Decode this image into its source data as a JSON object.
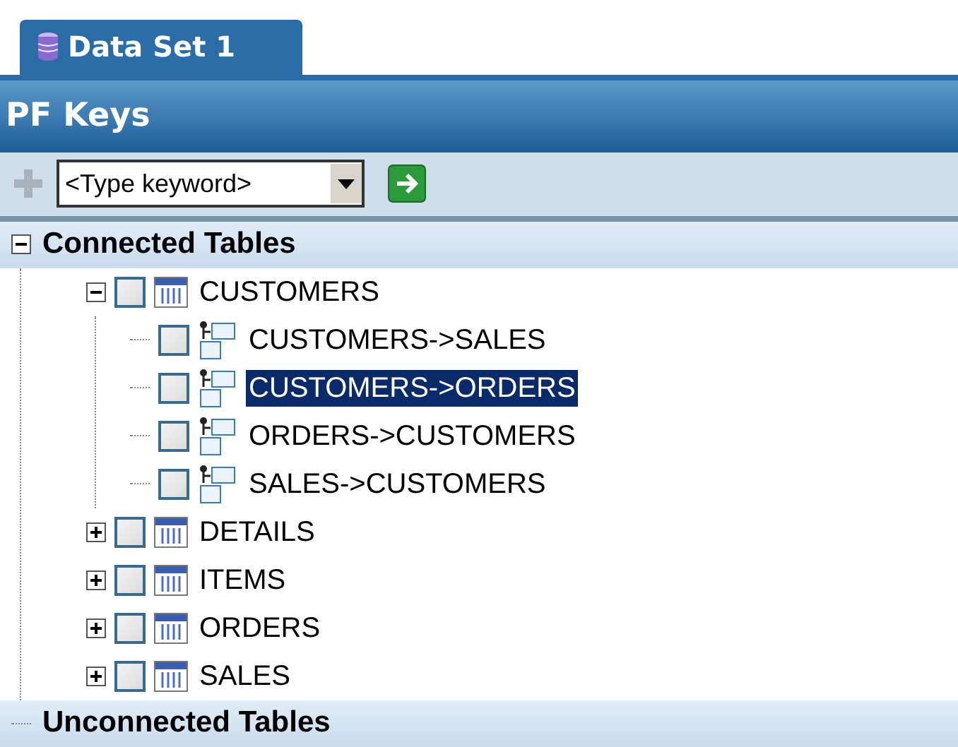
{
  "tab": {
    "label": "Data Set 1",
    "selected": true
  },
  "panel": {
    "title": "PF Keys"
  },
  "toolbar": {
    "search": {
      "placeholder": "<Type keyword>"
    }
  },
  "tree": [
    {
      "label": "Connected Tables",
      "expanded": true,
      "children": [
        {
          "kind": "table",
          "label": "CUSTOMERS",
          "expanded": true,
          "checked": false,
          "selected": false,
          "children": [
            {
              "kind": "relation",
              "label": "CUSTOMERS->SALES",
              "checked": false,
              "selected": false
            },
            {
              "kind": "relation",
              "label": "CUSTOMERS->ORDERS",
              "checked": false,
              "selected": true
            },
            {
              "kind": "relation",
              "label": "ORDERS->CUSTOMERS",
              "checked": false,
              "selected": false
            },
            {
              "kind": "relation",
              "label": "SALES->CUSTOMERS",
              "checked": false,
              "selected": false
            }
          ]
        },
        {
          "kind": "table",
          "label": "DETAILS",
          "expanded": false,
          "checked": false,
          "selected": false
        },
        {
          "kind": "table",
          "label": "ITEMS",
          "expanded": false,
          "checked": false,
          "selected": false
        },
        {
          "kind": "table",
          "label": "ORDERS",
          "expanded": false,
          "checked": false,
          "selected": false
        },
        {
          "kind": "table",
          "label": "SALES",
          "expanded": false,
          "checked": false,
          "selected": false
        }
      ]
    },
    {
      "label": "Unconnected Tables"
    }
  ]
}
